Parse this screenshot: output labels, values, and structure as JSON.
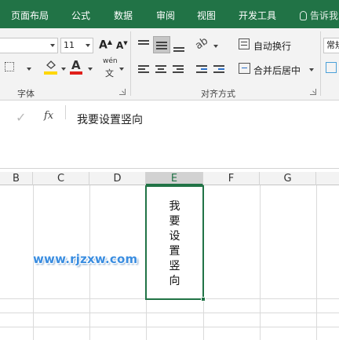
{
  "menu": {
    "tabs": [
      "页面布局",
      "公式",
      "数据",
      "审阅",
      "视图",
      "开发工具"
    ],
    "tell_me": "告诉我"
  },
  "ribbon": {
    "font_size": "11",
    "font_name_partial": "",
    "increase_font": "A",
    "decrease_font": "A",
    "bold_underline_text": "A",
    "phonetic_label": "wén",
    "wrap_text": "自动换行",
    "merge_center": "合并后居中",
    "number_format_partial": "常规",
    "group_font": "字体",
    "group_alignment": "对齐方式",
    "colors": {
      "fill_yellow": "#ffd700",
      "font_red": "#e0201b"
    }
  },
  "formula_bar": {
    "cancel_icon": "✓",
    "fx_label": "fx",
    "content": "我要设置竖向"
  },
  "sheet": {
    "columns": [
      "B",
      "C",
      "D",
      "E",
      "F",
      "G"
    ],
    "selected_column": "E",
    "selected_cell_text": [
      "我",
      "要",
      "设",
      "置",
      "竖",
      "向"
    ]
  },
  "watermark": "www.rjzxw.com",
  "theme": {
    "accent": "#217346",
    "watermark_color": "#3a8de0"
  }
}
